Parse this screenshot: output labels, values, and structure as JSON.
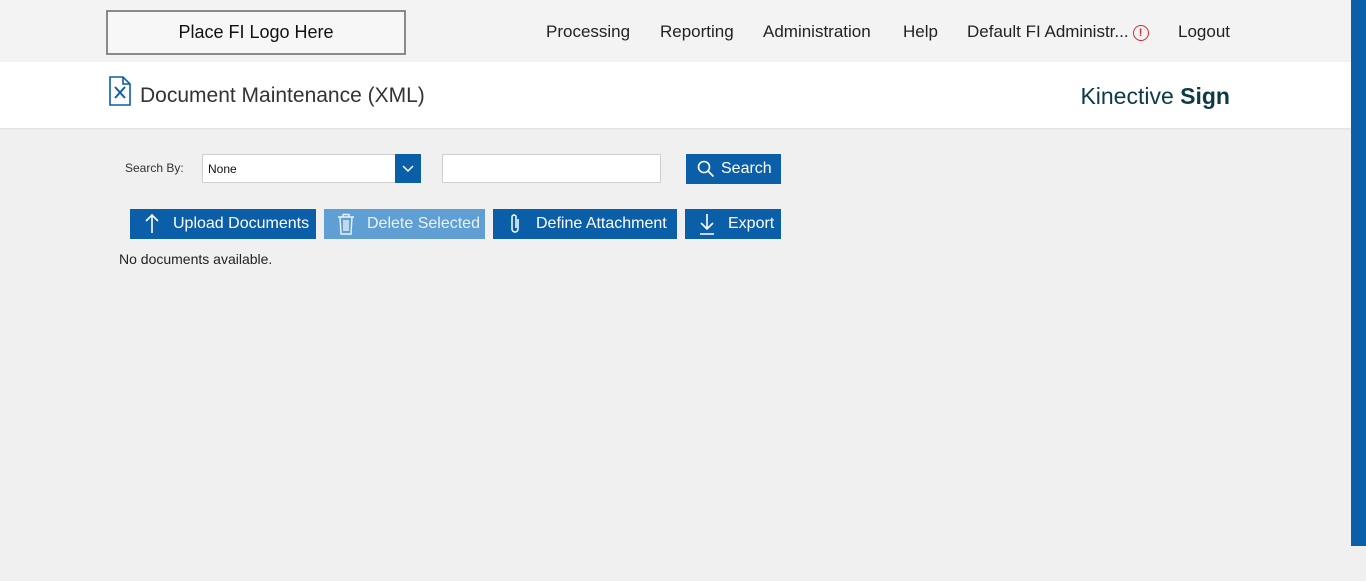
{
  "header": {
    "logo_text": "Place FI Logo Here",
    "nav": {
      "processing": "Processing",
      "reporting": "Reporting",
      "administration": "Administration",
      "help": "Help",
      "user": "Default FI Administr...",
      "logout": "Logout"
    },
    "alert_icon": "exclamation-circle-icon"
  },
  "titlebar": {
    "page_title": "Document Maintenance (XML)",
    "brand_regular": "Kinective",
    "brand_bold": "Sign",
    "icon": "document-tools-icon"
  },
  "search": {
    "label": "Search By:",
    "selected": "None",
    "text_value": "",
    "button_label": "Search"
  },
  "actions": {
    "upload": "Upload Documents",
    "delete": "Delete Selected",
    "define": "Define Attachment",
    "export": "Export"
  },
  "message": "No documents available.",
  "colors": {
    "primary": "#0b5ea8",
    "primary_disabled": "#5f9fd4",
    "brand_text": "#0d3b45",
    "alert": "#d9262b",
    "background": "#f0f0f0"
  }
}
